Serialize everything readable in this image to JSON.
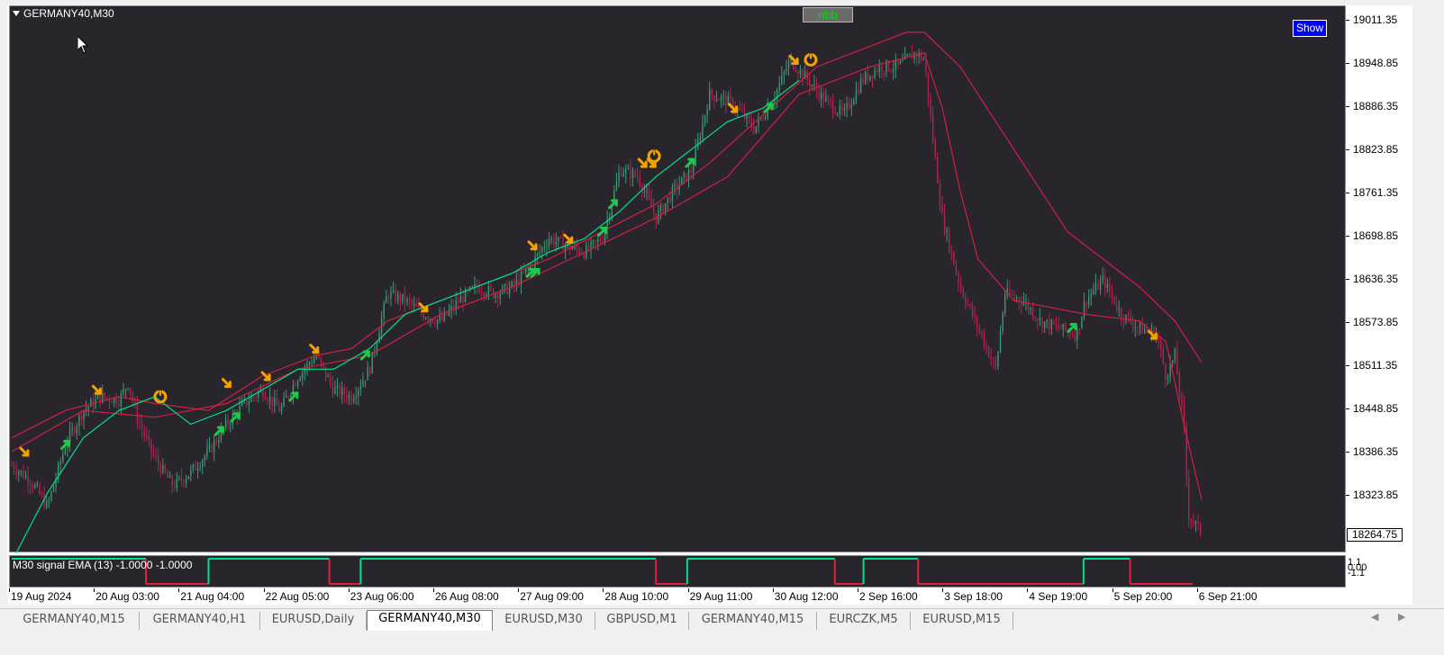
{
  "chart": {
    "symbol_title": "GERMANY40,M30",
    "ribb_label": "ribb",
    "show_label": "Show",
    "indicator_label": "M30 signal EMA (13) -1.0000 -1.0000",
    "current_price": "18264.75",
    "price_labels": [
      "19011.35",
      "18948.85",
      "18886.35",
      "18823.85",
      "18761.35",
      "18698.85",
      "18636.35",
      "18573.85",
      "18511.35",
      "18448.85",
      "18386.35",
      "18323.85"
    ],
    "indicator_levels": [
      "1.1",
      "0.00",
      "-1.1"
    ],
    "time_labels": [
      "19 Aug 2024",
      "20 Aug 03:00",
      "21 Aug 04:00",
      "22 Aug 05:00",
      "23 Aug 06:00",
      "26 Aug 08:00",
      "27 Aug 09:00",
      "28 Aug 10:00",
      "29 Aug 11:00",
      "30 Aug 12:00",
      "2 Sep 16:00",
      "3 Sep 18:00",
      "4 Sep 19:00",
      "5 Sep 20:00",
      "6 Sep 21:00"
    ],
    "colors": {
      "background": "#29252d",
      "bull_candle": "#3a9a72",
      "bear_candle": "#b0244c",
      "ema_fast": "#00e08a",
      "ema_slow": "#d0203f",
      "signal_buy": "#1fc94a",
      "signal_sell": "#f5a300",
      "osc_up": "#00e08a",
      "osc_down": "#e0203f"
    }
  },
  "tabs": [
    {
      "label": "GERMANY40,M15",
      "active": false
    },
    {
      "label": "GERMANY40,H1",
      "active": false
    },
    {
      "label": "EURUSD,Daily",
      "active": false
    },
    {
      "label": "GERMANY40,M30",
      "active": true
    },
    {
      "label": "EURUSD,M30",
      "active": false
    },
    {
      "label": "GBPUSD,M1",
      "active": false
    },
    {
      "label": "GERMANY40,M15",
      "active": false
    },
    {
      "label": "EURCZK,M5",
      "active": false
    },
    {
      "label": "EURUSD,M15",
      "active": false
    }
  ],
  "chart_data": {
    "type": "line",
    "ylim": [
      18240,
      19020
    ],
    "price_series": [
      [
        0,
        18360
      ],
      [
        20,
        18340
      ],
      [
        40,
        18300
      ],
      [
        60,
        18390
      ],
      [
        80,
        18440
      ],
      [
        100,
        18460
      ],
      [
        120,
        18455
      ],
      [
        130,
        18480
      ],
      [
        140,
        18430
      ],
      [
        160,
        18370
      ],
      [
        180,
        18330
      ],
      [
        200,
        18350
      ],
      [
        220,
        18380
      ],
      [
        240,
        18420
      ],
      [
        260,
        18450
      ],
      [
        280,
        18470
      ],
      [
        300,
        18440
      ],
      [
        320,
        18490
      ],
      [
        340,
        18520
      ],
      [
        360,
        18470
      ],
      [
        380,
        18460
      ],
      [
        400,
        18500
      ],
      [
        420,
        18610
      ],
      [
        440,
        18600
      ],
      [
        460,
        18580
      ],
      [
        480,
        18570
      ],
      [
        500,
        18600
      ],
      [
        520,
        18620
      ],
      [
        540,
        18610
      ],
      [
        560,
        18620
      ],
      [
        580,
        18650
      ],
      [
        600,
        18690
      ],
      [
        620,
        18680
      ],
      [
        640,
        18670
      ],
      [
        660,
        18690
      ],
      [
        680,
        18790
      ],
      [
        700,
        18780
      ],
      [
        720,
        18720
      ],
      [
        740,
        18760
      ],
      [
        760,
        18790
      ],
      [
        780,
        18900
      ],
      [
        800,
        18890
      ],
      [
        810,
        18880
      ],
      [
        830,
        18850
      ],
      [
        850,
        18890
      ],
      [
        870,
        18950
      ],
      [
        890,
        18920
      ],
      [
        910,
        18890
      ],
      [
        930,
        18870
      ],
      [
        950,
        18920
      ],
      [
        970,
        18940
      ],
      [
        990,
        18940
      ],
      [
        1010,
        18960
      ],
      [
        1020,
        18950
      ],
      [
        1030,
        18830
      ],
      [
        1040,
        18720
      ],
      [
        1060,
        18620
      ],
      [
        1080,
        18560
      ],
      [
        1100,
        18500
      ],
      [
        1110,
        18610
      ],
      [
        1130,
        18600
      ],
      [
        1150,
        18570
      ],
      [
        1170,
        18560
      ],
      [
        1190,
        18550
      ],
      [
        1200,
        18600
      ],
      [
        1220,
        18630
      ],
      [
        1240,
        18580
      ],
      [
        1260,
        18560
      ],
      [
        1280,
        18550
      ],
      [
        1290,
        18490
      ],
      [
        1300,
        18520
      ],
      [
        1310,
        18420
      ],
      [
        1315,
        18290
      ],
      [
        1325,
        18270
      ],
      [
        1330,
        18264
      ]
    ],
    "ema_fast_series": [
      [
        0,
        18220
      ],
      [
        40,
        18320
      ],
      [
        80,
        18400
      ],
      [
        120,
        18440
      ],
      [
        160,
        18460
      ],
      [
        200,
        18420
      ],
      [
        240,
        18440
      ],
      [
        280,
        18470
      ],
      [
        320,
        18500
      ],
      [
        360,
        18500
      ],
      [
        400,
        18530
      ],
      [
        440,
        18580
      ],
      [
        480,
        18600
      ],
      [
        520,
        18620
      ],
      [
        560,
        18640
      ],
      [
        600,
        18670
      ],
      [
        640,
        18690
      ],
      [
        680,
        18730
      ],
      [
        720,
        18780
      ],
      [
        760,
        18820
      ],
      [
        800,
        18860
      ],
      [
        840,
        18880
      ],
      [
        880,
        18920
      ]
    ],
    "ema_slow_series": [
      [
        0,
        18400
      ],
      [
        60,
        18440
      ],
      [
        120,
        18460
      ],
      [
        160,
        18450
      ],
      [
        220,
        18440
      ],
      [
        280,
        18490
      ],
      [
        340,
        18520
      ],
      [
        380,
        18530
      ],
      [
        420,
        18570
      ],
      [
        480,
        18600
      ],
      [
        540,
        18630
      ],
      [
        600,
        18660
      ],
      [
        660,
        18700
      ],
      [
        720,
        18740
      ],
      [
        780,
        18800
      ],
      [
        840,
        18870
      ],
      [
        900,
        18940
      ],
      [
        960,
        18970
      ],
      [
        1000,
        18990
      ],
      [
        1020,
        18990
      ],
      [
        1060,
        18940
      ],
      [
        1100,
        18860
      ],
      [
        1140,
        18780
      ],
      [
        1180,
        18700
      ],
      [
        1220,
        18660
      ],
      [
        1260,
        18620
      ],
      [
        1300,
        18570
      ],
      [
        1330,
        18510
      ]
    ],
    "ema_mid_series": [
      [
        0,
        18380
      ],
      [
        80,
        18440
      ],
      [
        160,
        18430
      ],
      [
        240,
        18450
      ],
      [
        320,
        18500
      ],
      [
        400,
        18520
      ],
      [
        480,
        18580
      ],
      [
        560,
        18620
      ],
      [
        640,
        18670
      ],
      [
        720,
        18720
      ],
      [
        800,
        18780
      ],
      [
        880,
        18900
      ],
      [
        960,
        18940
      ],
      [
        1020,
        18960
      ],
      [
        1040,
        18880
      ],
      [
        1060,
        18760
      ],
      [
        1080,
        18660
      ],
      [
        1120,
        18600
      ],
      [
        1200,
        18580
      ],
      [
        1260,
        18570
      ],
      [
        1290,
        18540
      ],
      [
        1310,
        18420
      ],
      [
        1330,
        18310
      ]
    ],
    "oscillator_segments": [
      {
        "x0": 0,
        "x1": 150,
        "value": 1.1
      },
      {
        "x0": 150,
        "x1": 220,
        "value": -1.1
      },
      {
        "x0": 220,
        "x1": 355,
        "value": 1.1
      },
      {
        "x0": 355,
        "x1": 390,
        "value": -1.1
      },
      {
        "x0": 390,
        "x1": 720,
        "value": 1.1
      },
      {
        "x0": 720,
        "x1": 755,
        "value": -1.1
      },
      {
        "x0": 755,
        "x1": 920,
        "value": 1.1
      },
      {
        "x0": 920,
        "x1": 952,
        "value": -1.1
      },
      {
        "x0": 952,
        "x1": 1013,
        "value": 1.1
      },
      {
        "x0": 1013,
        "x1": 1198,
        "value": -1.1
      },
      {
        "x0": 1198,
        "x1": 1250,
        "value": 1.1
      },
      {
        "x0": 1250,
        "x1": 1320,
        "value": -1.1
      }
    ],
    "buy_signals": [
      [
        60,
        18390
      ],
      [
        232,
        18410
      ],
      [
        250,
        18430
      ],
      [
        315,
        18460
      ],
      [
        395,
        18520
      ],
      [
        580,
        18640
      ],
      [
        585,
        18640
      ],
      [
        660,
        18700
      ],
      [
        672,
        18740
      ],
      [
        758,
        18800
      ],
      [
        846,
        18880
      ],
      [
        1185,
        18560
      ]
    ],
    "sell_signals": [
      [
        14,
        18380
      ],
      [
        95,
        18470
      ],
      [
        240,
        18480
      ],
      [
        284,
        18490
      ],
      [
        338,
        18530
      ],
      [
        460,
        18590
      ],
      [
        582,
        18680
      ],
      [
        622,
        18690
      ],
      [
        705,
        18800
      ],
      [
        715,
        18800
      ],
      [
        806,
        18880
      ],
      [
        874,
        18950
      ],
      [
        1275,
        18550
      ]
    ],
    "exit_signals": [
      [
        166,
        18460
      ],
      [
        718,
        18810
      ],
      [
        893,
        18950
      ]
    ]
  }
}
